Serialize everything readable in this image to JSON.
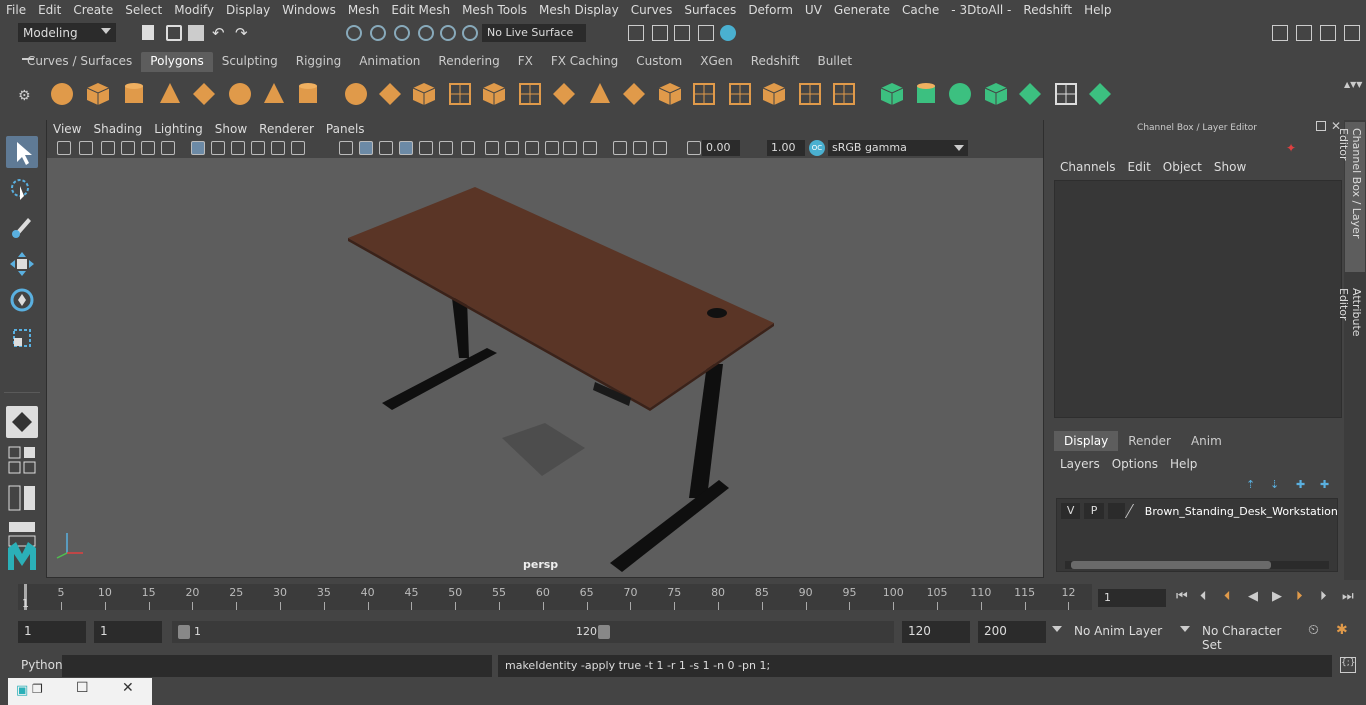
{
  "menubar": [
    "File",
    "Edit",
    "Create",
    "Select",
    "Modify",
    "Display",
    "Windows",
    "Mesh",
    "Edit Mesh",
    "Mesh Tools",
    "Mesh Display",
    "Curves",
    "Surfaces",
    "Deform",
    "UV",
    "Generate",
    "Cache",
    "- 3DtoAll -",
    "Redshift",
    "Help"
  ],
  "status": {
    "mode": "Modeling",
    "live_surface": "No Live Surface"
  },
  "shelf_tabs": [
    "Curves / Surfaces",
    "Polygons",
    "Sculpting",
    "Rigging",
    "Animation",
    "Rendering",
    "FX",
    "FX Caching",
    "Custom",
    "XGen",
    "Redshift",
    "Bullet"
  ],
  "shelf_active": "Polygons",
  "viewport": {
    "menu": [
      "View",
      "Shading",
      "Lighting",
      "Show",
      "Renderer",
      "Panels"
    ],
    "exposure": "0.00",
    "gamma": "1.00",
    "colorspace": "sRGB gamma",
    "camera": "persp"
  },
  "channel_box": {
    "title": "Channel Box / Layer Editor",
    "menu": [
      "Channels",
      "Edit",
      "Object",
      "Show"
    ],
    "side_tabs": [
      "Channel Box / Layer Editor",
      "Attribute Editor"
    ]
  },
  "layer_editor": {
    "tabs": [
      "Display",
      "Render",
      "Anim"
    ],
    "active_tab": "Display",
    "menu": [
      "Layers",
      "Options",
      "Help"
    ],
    "layer": {
      "v": "V",
      "p": "P",
      "name": "Brown_Standing_Desk_Workstation_"
    }
  },
  "timeline": {
    "labels": [
      "5",
      "10",
      "15",
      "20",
      "25",
      "30",
      "35",
      "40",
      "45",
      "50",
      "55",
      "60",
      "65",
      "70",
      "75",
      "80",
      "85",
      "90",
      "95",
      "100",
      "105",
      "110",
      "115",
      "12"
    ],
    "current_frame": "1",
    "start_label": "1"
  },
  "range": {
    "start": "1",
    "playback_start": "1",
    "slider_start": "1",
    "slider_end": "120",
    "playback_end": "120",
    "end": "200",
    "anim_layer": "No Anim Layer",
    "char_set": "No Character Set"
  },
  "command": {
    "lang": "Python",
    "output": "makeIdentity -apply true -t 1 -r 1 -s 1 -n 0 -pn 1;"
  },
  "colors": {
    "accent": "#e09a4a",
    "bg": "#444444",
    "viewport": "#5d5d5d",
    "desk": "#5a3526"
  }
}
